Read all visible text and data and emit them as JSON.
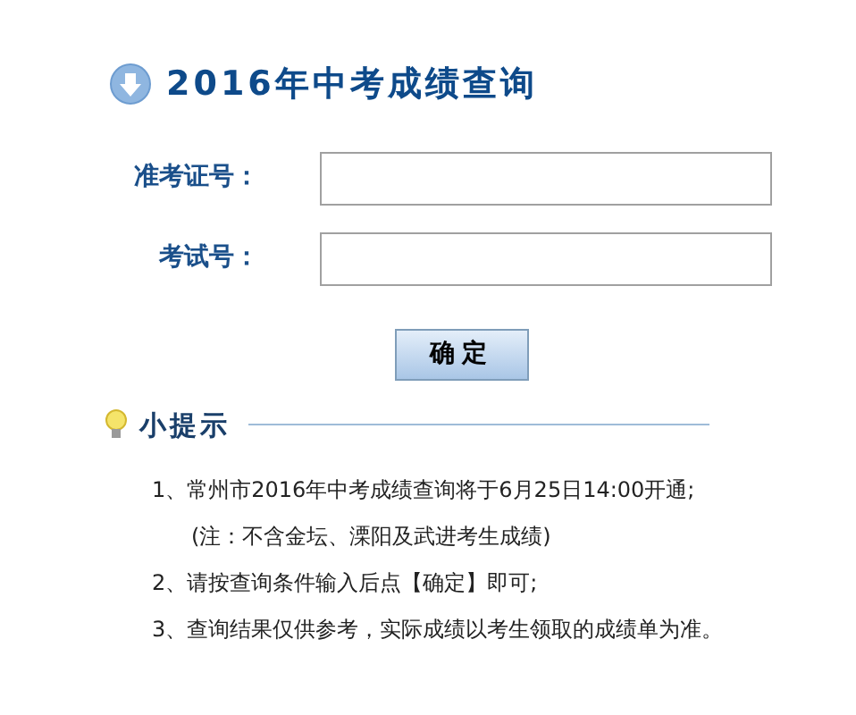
{
  "title": "2016年中考成绩查询",
  "form": {
    "fields": [
      {
        "label": "准考证号："
      },
      {
        "label": "考试号："
      }
    ],
    "submit": "确定"
  },
  "tips": {
    "title": "小提示",
    "items": [
      {
        "kind": "item",
        "text": "1、常州市2016年中考成绩查询将于6月25日14:00开通;"
      },
      {
        "kind": "note",
        "text": "(注：不含金坛、溧阳及武进考生成绩)"
      },
      {
        "kind": "item",
        "text": "2、请按查询条件输入后点【确定】即可;"
      },
      {
        "kind": "item",
        "text": "3、查询结果仅供参考，实际成绩以考生领取的成绩单为准。"
      }
    ]
  }
}
